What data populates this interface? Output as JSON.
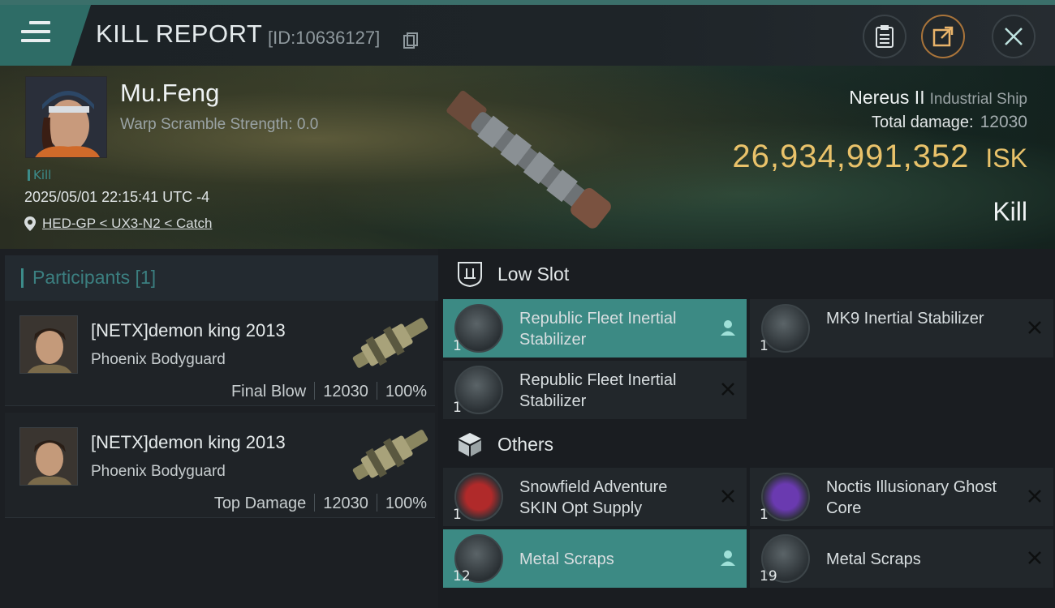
{
  "header": {
    "title": "KILL REPORT",
    "report_id": "[ID:10636127]"
  },
  "victim": {
    "name": "Mu.Feng",
    "warp_scramble": "Warp Scramble Strength: 0.0",
    "tag": "Kill",
    "timestamp": "2025/05/01 22:15:41 UTC -4",
    "location": "HED-GP < UX3-N2 < Catch"
  },
  "ship": {
    "name": "Nereus II",
    "class": "Industrial Ship",
    "total_damage_label": "Total damage:",
    "total_damage": "12030",
    "isk_value": "26,934,991,352",
    "isk_unit": "ISK",
    "result": "Kill"
  },
  "participants": {
    "header": "Participants [1]",
    "cards": [
      {
        "name": "[NETX]demon king 2013",
        "ship": "Phoenix Bodyguard",
        "role": "Final Blow",
        "damage": "12030",
        "percent": "100%"
      },
      {
        "name": "[NETX]demon king 2013",
        "ship": "Phoenix Bodyguard",
        "role": "Top Damage",
        "damage": "12030",
        "percent": "100%"
      }
    ]
  },
  "modules": {
    "low_slot_label": "Low Slot",
    "others_label": "Others",
    "low_slot": [
      {
        "name": "Republic Fleet Inertial Stabilizer",
        "qty": "1",
        "status": "person-icon"
      },
      {
        "name": "MK9 Inertial Stabilizer",
        "qty": "1",
        "status": "close-icon"
      },
      {
        "name": "Republic Fleet Inertial Stabilizer",
        "qty": "1",
        "status": "close-icon"
      }
    ],
    "others": [
      {
        "name": "Snowfield Adventure SKIN Opt Supply",
        "qty": "1",
        "status": "close-icon"
      },
      {
        "name": "Noctis Illusionary Ghost Core",
        "qty": "1",
        "status": "close-icon"
      },
      {
        "name": "Metal Scraps",
        "qty": "12",
        "status": "person-icon"
      },
      {
        "name": "Metal Scraps",
        "qty": "19",
        "status": "close-icon"
      }
    ]
  },
  "colors": {
    "accent": "#3c8a84",
    "isk": "#e9c26a",
    "panel": "#22272b"
  }
}
